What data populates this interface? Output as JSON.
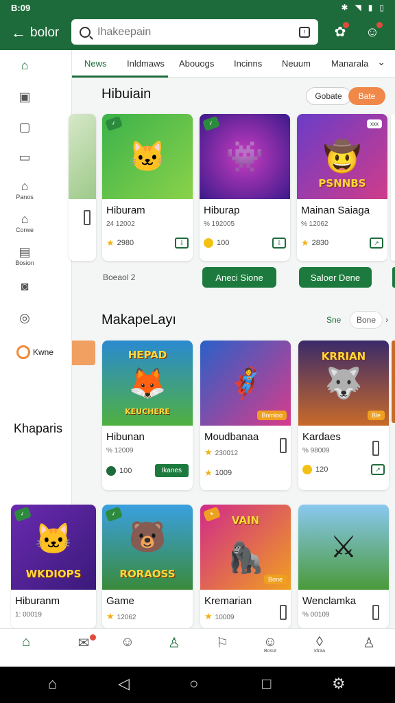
{
  "status": {
    "time": "B:09",
    "icons": [
      "bluetooth-icon",
      "wifi-icon",
      "signal-icon",
      "battery-icon"
    ]
  },
  "appbar": {
    "back_label": "bolor",
    "search_placeholder": "Ihakeepain",
    "scan_label": "!"
  },
  "tabs": [
    {
      "label": "News"
    },
    {
      "label": "Inldmaws"
    },
    {
      "label": "Abouogs"
    },
    {
      "label": "Incinns"
    },
    {
      "label": "Neuum"
    },
    {
      "label": "Manarala"
    }
  ],
  "rail": {
    "items": [
      {
        "label": ""
      },
      {
        "label": ""
      },
      {
        "label": ""
      },
      {
        "label": ""
      },
      {
        "label": "Panos"
      },
      {
        "label": "Corwe"
      },
      {
        "label": "Bosion"
      },
      {
        "label": ""
      },
      {
        "label": ""
      }
    ],
    "brand_label": "Kwne",
    "side_heading": "Khaparis"
  },
  "section1": {
    "title": "Hibuiain",
    "pill_a": "Gobate",
    "pill_b": "Bate",
    "footer_text": "Boeaol 2",
    "btn_a": "Aneci Sione",
    "btn_b": "Saloer Dene",
    "cards": [
      {
        "name": "Hiburam",
        "meta": "24 12002",
        "value": "2980"
      },
      {
        "name": "Hiburap",
        "meta": "% 192005",
        "value": "100"
      },
      {
        "name": "Mainan Saiaga",
        "meta": "% 12062",
        "value": "2830",
        "art_text": "PSNNBS",
        "corner": "xxx"
      }
    ]
  },
  "section2": {
    "title": "MakapeLayı",
    "link_a": "Sne",
    "link_b": "Bone",
    "cards": [
      {
        "name": "Hibunan",
        "meta": "% 12009",
        "value": "100",
        "btn": "Ikanes",
        "art_text": "HEPAD",
        "art_sub": "KEUCHERE"
      },
      {
        "name": "Moudbanaa",
        "meta": "230012",
        "value": "1009",
        "badge": "Bomioo"
      },
      {
        "name": "Kardaes",
        "meta": "% 98009",
        "value": "120",
        "art_text": "KRRIAN",
        "badge": "Ble"
      }
    ]
  },
  "section3": {
    "cards": [
      {
        "name": "Hiburanm",
        "meta": "1: 00019",
        "art_text": "WKDIOPS"
      },
      {
        "name": "Game",
        "meta": "12062",
        "art_text": "RORAOSS"
      },
      {
        "name": "Kremarian",
        "meta": "10009",
        "art_text": "VAIN",
        "badge": "Bone"
      },
      {
        "name": "Wenclamka",
        "meta": "% 00109"
      }
    ]
  },
  "bottom_nav": [
    {
      "label": ""
    },
    {
      "label": ""
    },
    {
      "label": ""
    },
    {
      "label": ""
    },
    {
      "label": ""
    },
    {
      "label": "Bosut"
    },
    {
      "label": "Idraa"
    },
    {
      "label": ""
    }
  ]
}
